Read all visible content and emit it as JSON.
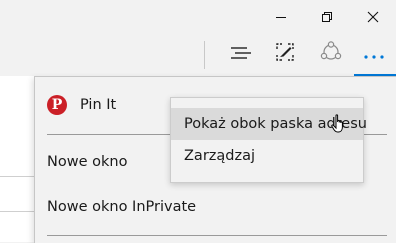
{
  "window_controls": {
    "minimize_icon": "minimize-icon",
    "restore_icon": "restore-icon",
    "close_icon": "close-icon"
  },
  "toolbar": {
    "icons": [
      "hub-icon",
      "web-note-icon",
      "share-icon",
      "more-icon"
    ],
    "accent": "#0078d7"
  },
  "menu": {
    "items": [
      {
        "label": "Pin It",
        "icon": "pinterest-icon",
        "icon_color": "#cb2027"
      },
      {
        "label": "Nowe okno"
      },
      {
        "label": "Nowe okno InPrivate"
      }
    ]
  },
  "submenu": {
    "items": [
      {
        "label": "Pokaż obok paska adresu",
        "state": "hover"
      },
      {
        "label": "Zarządzaj"
      }
    ]
  }
}
